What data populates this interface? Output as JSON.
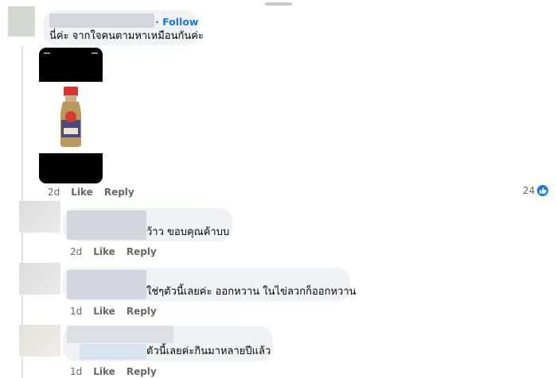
{
  "top_comment": {
    "follow_label": "· Follow",
    "text": "นี่ค่ะ จากใจคนตามหาเหมือนกันค่ะ",
    "time": "2d",
    "like_label": "Like",
    "reply_label": "Reply",
    "reaction_count": "24",
    "reaction_icon": "like-icon",
    "attachment": "screenshot of a sauce bottle with a red cap"
  },
  "replies": [
    {
      "text": "ว้าว ขอบคุณค้าบบ",
      "time": "2d",
      "like_label": "Like",
      "reply_label": "Reply"
    },
    {
      "text": "ใช่ๆตัวนี้เลยค่ะ ออกหวาน ในไข่ลวกก็ออกหวาน",
      "time": "1d",
      "like_label": "Like",
      "reply_label": "Reply"
    },
    {
      "text": "ตัวนี้เลยค่ะกินมาหลายปีแล้ว",
      "time": "1d",
      "like_label": "Like",
      "reply_label": "Reply"
    }
  ],
  "colors": {
    "link": "#1877f2",
    "bubble": "#f0f2f5",
    "meta": "#65676b"
  }
}
